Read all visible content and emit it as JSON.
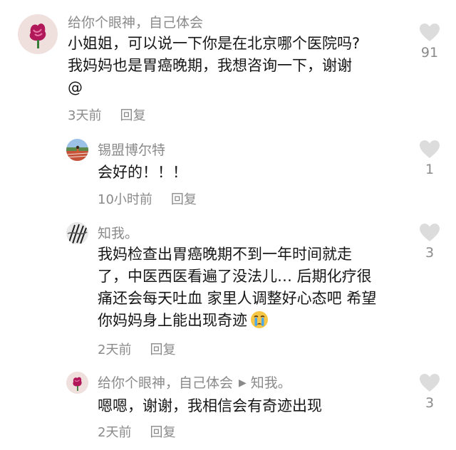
{
  "comments": [
    {
      "username": "给你个眼神，自己体会",
      "lines": [
        "小姐姐，可以说一下你是在北京哪个医院吗?",
        "我妈妈也是胃癌晚期，我想咨询一下，谢谢",
        "@"
      ],
      "time": "3天前",
      "reply_label": "回复",
      "likes": "91"
    },
    {
      "username": "锡盟博尔特",
      "lines": [
        "会好的！！！"
      ],
      "time": "10小时前",
      "reply_label": "回复",
      "likes": "1"
    },
    {
      "username": "知我。",
      "lines": [
        "我妈检查出胃癌晚期不到一年时间就走",
        "了，中医西医看遍了没法儿… 后期化疗很",
        "痛还会每天吐血 家里人调整好心态吧 希望",
        "你妈妈身上能出现奇迹"
      ],
      "time": "2天前",
      "reply_label": "回复",
      "likes": "3"
    },
    {
      "username": "给你个眼神，自己体会",
      "reply_target": "知我。",
      "lines": [
        "嗯嗯，谢谢，我相信会有奇迹出现"
      ],
      "time": "2天前",
      "reply_label": "回复",
      "likes": "3"
    }
  ],
  "colors": {
    "text": "#161616",
    "muted": "#8a8a8a",
    "heart": "#dcdcdc",
    "avatar_flower": "#b0185a",
    "avatar_bg": "#efe0de"
  },
  "icons": {
    "like": "heart-icon",
    "reply_arrow": "triangle-right-icon",
    "emoji": "crying-face-emoji"
  }
}
